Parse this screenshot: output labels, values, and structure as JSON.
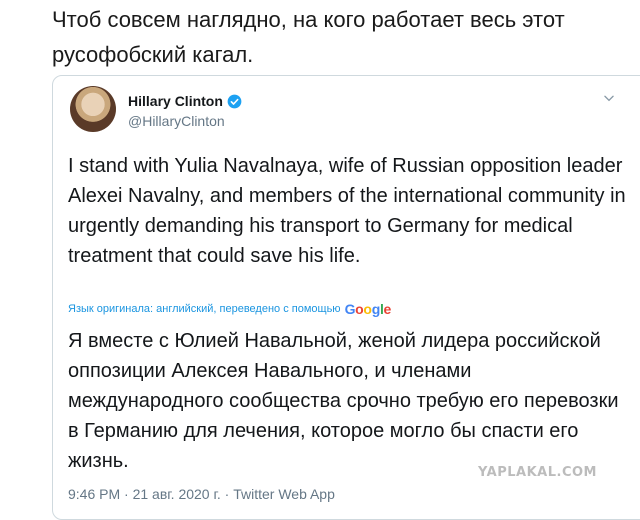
{
  "post": {
    "intro_text": "Чтоб совсем наглядно, на кого работает весь этот русофобский кагал."
  },
  "tweet": {
    "author_name": "Hillary Clinton",
    "author_handle": "@HillaryClinton",
    "text": "I stand with Yulia Navalnaya, wife of Russian opposition leader Alexei Navalny, and members of the international community in urgently demanding his transport to Germany for medical treatment that could save his life.",
    "translation_label": "Язык оригинала: английский, переведено с помощью",
    "translation_provider": "Google",
    "translated_text": "Я вместе с Юлией Навальной, женой лидера российской оппозиции Алексея Навального, и членами международного сообщества срочно требую его перевозки в Германию для лечения, которое могло бы спасти его жизнь.",
    "timestamp": "9:46 PM · 21 авг. 2020 г. · Twitter Web App",
    "icons": {
      "verified": "verified-badge-icon",
      "menu": "chevron-down-icon"
    },
    "colors": {
      "link": "#1b95e0",
      "verified": "#1da1f2",
      "muted": "#657786"
    }
  },
  "watermark": {
    "text": "YAPLAKAL.COM"
  }
}
